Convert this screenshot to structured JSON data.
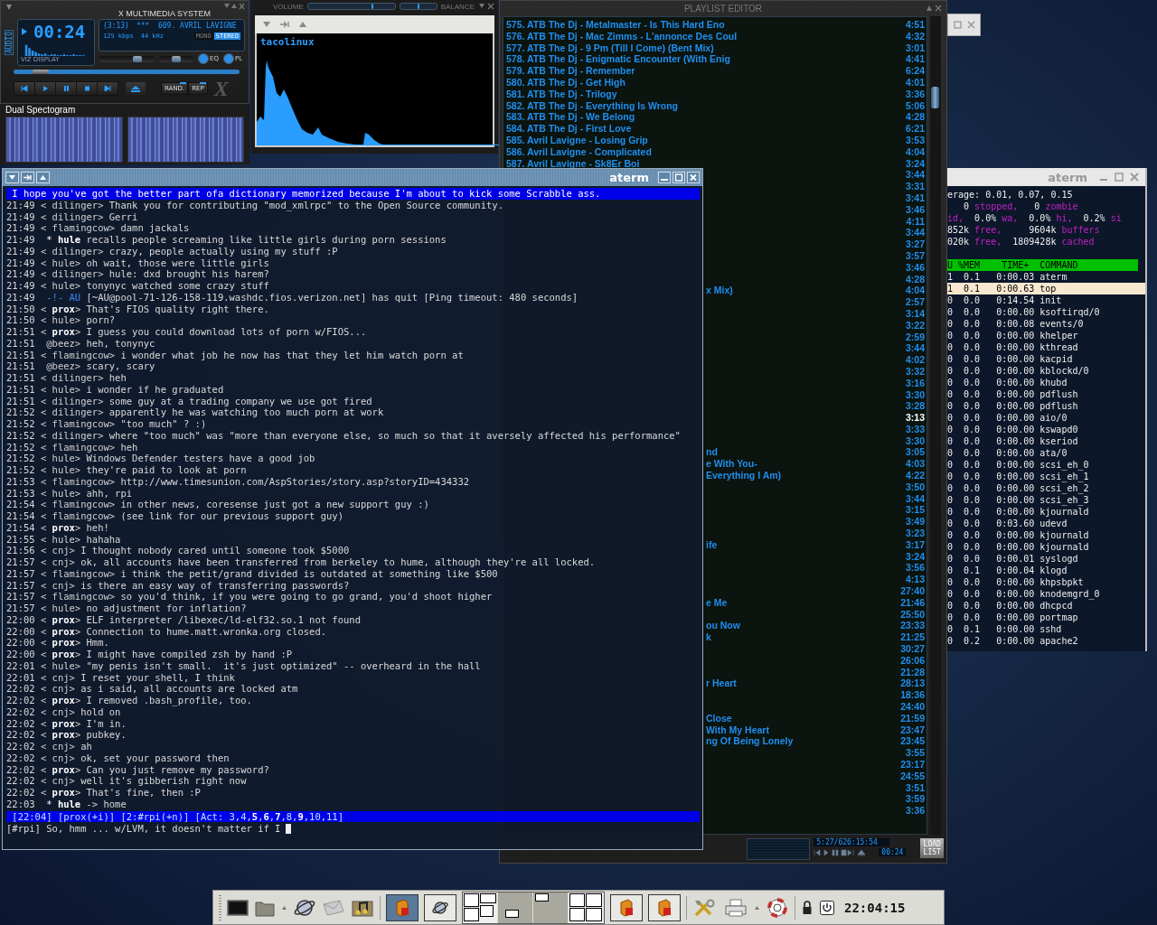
{
  "player": {
    "title": "X MULTIMEDIA SYSTEM",
    "side_label": "AUDIO",
    "viz_label": "VIZ DISPLAY",
    "time": "00:24",
    "track_time": "(3:13)",
    "marquee": "***  609. AVRIL LAVIGNE",
    "bitrate": "125 kbps",
    "samplerate": "44 kHz",
    "modes": [
      {
        "label": "MONO",
        "on": false
      },
      {
        "label": "STEREO",
        "on": true
      }
    ],
    "volume": {
      "level": 0.7
    },
    "balance": {
      "level": 0.5
    },
    "seek": {
      "level": 0.12
    },
    "panel_buttons": [
      {
        "label": "EQ",
        "on": true
      },
      {
        "label": "PL",
        "on": true
      }
    ],
    "toggles": [
      {
        "label": "RAND.",
        "on": true
      },
      {
        "label": "REP",
        "on": true
      }
    ],
    "logo": "X"
  },
  "spectrogram": {
    "title": "Dual Spectogram"
  },
  "visualizer": {
    "volume_label": "VOLUME",
    "balance_label": "BALANCE",
    "volume": {
      "level": 0.74
    },
    "balance": {
      "level": 0.5
    },
    "name": "tacolinux"
  },
  "playlist": {
    "title": "PLAYLIST EDITOR",
    "rows": [
      {
        "kind": "full",
        "title": "575. ATB The Dj - Metalmaster - Is This Hard Eno",
        "time": "4:51",
        "selected": false
      },
      {
        "kind": "full",
        "title": "576. ATB The Dj - Mac Zimms - L'annonce Des Coul",
        "time": "4:32",
        "selected": false
      },
      {
        "kind": "full",
        "title": "577. ATB The Dj - 9 Pm (Till I Come) (Bent Mix)",
        "time": "3:01",
        "selected": false
      },
      {
        "kind": "full",
        "title": "578. ATB The Dj - Enigmatic Encounter (With Enig",
        "time": "4:41",
        "selected": false
      },
      {
        "kind": "full",
        "title": "579. ATB The Dj - Remember",
        "time": "6:24",
        "selected": false
      },
      {
        "kind": "full",
        "title": "580. ATB The Dj - Get High",
        "time": "4:01",
        "selected": false
      },
      {
        "kind": "full",
        "title": "581. ATB The Dj - Trilogy",
        "time": "3:36",
        "selected": false
      },
      {
        "kind": "full",
        "title": "582. ATB The Dj - Everything Is Wrong",
        "time": "5:06",
        "selected": false
      },
      {
        "kind": "full",
        "title": "583. ATB The Dj - We Belong",
        "time": "4:28",
        "selected": false
      },
      {
        "kind": "full",
        "title": "584. ATB The Dj - First Love",
        "time": "6:21",
        "selected": false
      },
      {
        "kind": "full",
        "title": "585. Avril Lavigne - Losing Grip",
        "time": "3:53",
        "selected": false
      },
      {
        "kind": "full",
        "title": "586. Avril Lavigne - Complicated",
        "time": "4:04",
        "selected": false
      },
      {
        "kind": "full",
        "title": "587. Avril Lavigne - Sk8Er Boi",
        "time": "3:24",
        "selected": false
      },
      {
        "kind": "tail",
        "time": "3:44",
        "selected": false
      },
      {
        "kind": "tail",
        "time": "3:31",
        "selected": false
      },
      {
        "kind": "tail",
        "time": "3:41",
        "selected": false
      },
      {
        "kind": "tail",
        "time": "3:46",
        "selected": false
      },
      {
        "kind": "tail",
        "time": "4:11",
        "selected": false
      },
      {
        "kind": "tail",
        "time": "3:44",
        "selected": false
      },
      {
        "kind": "tail",
        "time": "3:27",
        "selected": false
      },
      {
        "kind": "tail",
        "time": "3:57",
        "selected": false
      },
      {
        "kind": "tail",
        "time": "3:46",
        "selected": false
      },
      {
        "kind": "tail",
        "time": "4:28",
        "selected": false
      },
      {
        "kind": "tail",
        "title": "x Mix)",
        "time": "4:04",
        "selected": false
      },
      {
        "kind": "tail",
        "time": "2:57",
        "selected": false
      },
      {
        "kind": "tail",
        "time": "3:14",
        "selected": false
      },
      {
        "kind": "tail",
        "time": "3:22",
        "selected": false
      },
      {
        "kind": "tail",
        "time": "2:59",
        "selected": false
      },
      {
        "kind": "tail",
        "time": "3:44",
        "selected": false
      },
      {
        "kind": "tail",
        "time": "4:02",
        "selected": false
      },
      {
        "kind": "tail",
        "time": "3:32",
        "selected": false
      },
      {
        "kind": "tail",
        "time": "3:16",
        "selected": false
      },
      {
        "kind": "tail",
        "time": "3:30",
        "selected": false
      },
      {
        "kind": "tail",
        "time": "3:28",
        "selected": false
      },
      {
        "kind": "tail",
        "time": "3:13",
        "selected": true
      },
      {
        "kind": "tail",
        "time": "3:33",
        "selected": false
      },
      {
        "kind": "tail",
        "time": "3:30",
        "selected": false
      },
      {
        "kind": "tail",
        "title": "nd",
        "time": "3:05",
        "selected": false
      },
      {
        "kind": "tail",
        "title": "e With You-",
        "time": "4:03",
        "selected": false
      },
      {
        "kind": "tail",
        "title": "Everything I Am)",
        "time": "4:22",
        "selected": false
      },
      {
        "kind": "tail",
        "time": "3:50",
        "selected": false
      },
      {
        "kind": "tail",
        "time": "3:44",
        "selected": false
      },
      {
        "kind": "tail",
        "time": "3:15",
        "selected": false
      },
      {
        "kind": "tail",
        "time": "3:49",
        "selected": false
      },
      {
        "kind": "tail",
        "time": "3:23",
        "selected": false
      },
      {
        "kind": "tail",
        "title": "ife",
        "time": "3:17",
        "selected": false
      },
      {
        "kind": "tail",
        "time": "3:24",
        "selected": false
      },
      {
        "kind": "tail",
        "time": "3:56",
        "selected": false
      },
      {
        "kind": "tail",
        "time": "4:13",
        "selected": false
      },
      {
        "kind": "tail",
        "time": "27:40",
        "selected": false
      },
      {
        "kind": "tail",
        "title": "e Me",
        "time": "21:46",
        "selected": false
      },
      {
        "kind": "tail",
        "time": "25:50",
        "selected": false
      },
      {
        "kind": "tail",
        "title": "ou Now",
        "time": "23:33",
        "selected": false
      },
      {
        "kind": "tail",
        "title": "k",
        "time": "21:25",
        "selected": false
      },
      {
        "kind": "tail",
        "time": "30:27",
        "selected": false
      },
      {
        "kind": "tail",
        "time": "26:06",
        "selected": false
      },
      {
        "kind": "tail",
        "time": "21:28",
        "selected": false
      },
      {
        "kind": "tail",
        "title": "r Heart",
        "time": "28:13",
        "selected": false
      },
      {
        "kind": "tail",
        "time": "18:36",
        "selected": false
      },
      {
        "kind": "tail",
        "time": "24:40",
        "selected": false
      },
      {
        "kind": "tail",
        "title": "Close",
        "time": "21:59",
        "selected": false
      },
      {
        "kind": "tail",
        "title": "With My Heart",
        "time": "23:47",
        "selected": false
      },
      {
        "kind": "tail",
        "title": "ng Of Being Lonely",
        "time": "23:45",
        "selected": false
      },
      {
        "kind": "tail",
        "time": "3:55",
        "selected": false
      },
      {
        "kind": "tail",
        "time": "23:17",
        "selected": false
      },
      {
        "kind": "tail",
        "time": "24:55",
        "selected": false
      },
      {
        "kind": "tail",
        "time": "3:51",
        "selected": false
      },
      {
        "kind": "tail",
        "time": "3:59",
        "selected": false
      },
      {
        "kind": "tail",
        "time": "3:36",
        "selected": false
      }
    ],
    "total": "5:27/626:15:54",
    "elapsed": "00:24",
    "load_button": "LOAD LIST"
  },
  "top_terminal": {
    "title": "aterm",
    "summary": [
      [
        {
          "text": "erage: 0.01, 0.07, 0.15",
          "kind": "value"
        }
      ],
      [
        {
          "text": "   0 ",
          "kind": "value"
        },
        {
          "text": "stopped,",
          "kind": "label"
        },
        {
          "text": "   0 ",
          "kind": "value"
        },
        {
          "text": "zombie",
          "kind": "label"
        }
      ],
      [
        {
          "text": "id,",
          "kind": "label"
        },
        {
          "text": "  0.0%",
          "kind": "value"
        },
        {
          "text": " wa,",
          "kind": "label"
        },
        {
          "text": "  0.0%",
          "kind": "value"
        },
        {
          "text": " hi,",
          "kind": "label"
        },
        {
          "text": "  0.2%",
          "kind": "value"
        },
        {
          "text": " si",
          "kind": "label"
        }
      ],
      [
        {
          "text": "852k",
          "kind": "value"
        },
        {
          "text": " free,",
          "kind": "label"
        },
        {
          "text": "     9604k",
          "kind": "value"
        },
        {
          "text": " buffers",
          "kind": "label"
        }
      ],
      [
        {
          "text": "020k",
          "kind": "value"
        },
        {
          "text": " free,",
          "kind": "label"
        },
        {
          "text": "  1809428k",
          "kind": "value"
        },
        {
          "text": " cached",
          "kind": "label"
        }
      ]
    ],
    "header": "U %MEM    TIME+  COMMAND",
    "processes": [
      {
        "cpu": "1",
        "mem": "0.1",
        "time": "0:00.03",
        "command": "aterm",
        "selected": false
      },
      {
        "cpu": "1",
        "mem": "0.1",
        "time": "0:00.63",
        "command": "top",
        "selected": true
      },
      {
        "cpu": "0",
        "mem": "0.0",
        "time": "0:14.54",
        "command": "init",
        "selected": false
      },
      {
        "cpu": "0",
        "mem": "0.0",
        "time": "0:00.00",
        "command": "ksoftirqd/0",
        "selected": false
      },
      {
        "cpu": "0",
        "mem": "0.0",
        "time": "0:00.08",
        "command": "events/0",
        "selected": false
      },
      {
        "cpu": "0",
        "mem": "0.0",
        "time": "0:00.00",
        "command": "khelper",
        "selected": false
      },
      {
        "cpu": "0",
        "mem": "0.0",
        "time": "0:00.00",
        "command": "kthread",
        "selected": false
      },
      {
        "cpu": "0",
        "mem": "0.0",
        "time": "0:00.00",
        "command": "kacpid",
        "selected": false
      },
      {
        "cpu": "0",
        "mem": "0.0",
        "time": "0:00.00",
        "command": "kblockd/0",
        "selected": false
      },
      {
        "cpu": "0",
        "mem": "0.0",
        "time": "0:00.00",
        "command": "khubd",
        "selected": false
      },
      {
        "cpu": "0",
        "mem": "0.0",
        "time": "0:00.00",
        "command": "pdflush",
        "selected": false
      },
      {
        "cpu": "0",
        "mem": "0.0",
        "time": "0:00.00",
        "command": "pdflush",
        "selected": false
      },
      {
        "cpu": "0",
        "mem": "0.0",
        "time": "0:00.00",
        "command": "aio/0",
        "selected": false
      },
      {
        "cpu": "0",
        "mem": "0.0",
        "time": "0:00.00",
        "command": "kswapd0",
        "selected": false
      },
      {
        "cpu": "0",
        "mem": "0.0",
        "time": "0:00.00",
        "command": "kseriod",
        "selected": false
      },
      {
        "cpu": "0",
        "mem": "0.0",
        "time": "0:00.00",
        "command": "ata/0",
        "selected": false
      },
      {
        "cpu": "0",
        "mem": "0.0",
        "time": "0:00.00",
        "command": "scsi_eh_0",
        "selected": false
      },
      {
        "cpu": "0",
        "mem": "0.0",
        "time": "0:00.00",
        "command": "scsi_eh_1",
        "selected": false
      },
      {
        "cpu": "0",
        "mem": "0.0",
        "time": "0:00.00",
        "command": "scsi_eh_2",
        "selected": false
      },
      {
        "cpu": "0",
        "mem": "0.0",
        "time": "0:00.00",
        "command": "scsi_eh_3",
        "selected": false
      },
      {
        "cpu": "0",
        "mem": "0.0",
        "time": "0:00.00",
        "command": "kjournald",
        "selected": false
      },
      {
        "cpu": "0",
        "mem": "0.0",
        "time": "0:03.60",
        "command": "udevd",
        "selected": false
      },
      {
        "cpu": "0",
        "mem": "0.0",
        "time": "0:00.00",
        "command": "kjournald",
        "selected": false
      },
      {
        "cpu": "0",
        "mem": "0.0",
        "time": "0:00.00",
        "command": "kjournald",
        "selected": false
      },
      {
        "cpu": "0",
        "mem": "0.0",
        "time": "0:00.01",
        "command": "syslogd",
        "selected": false
      },
      {
        "cpu": "0",
        "mem": "0.1",
        "time": "0:00.04",
        "command": "klogd",
        "selected": false
      },
      {
        "cpu": "0",
        "mem": "0.0",
        "time": "0:00.00",
        "command": "khpsbpkt",
        "selected": false
      },
      {
        "cpu": "0",
        "mem": "0.0",
        "time": "0:00.00",
        "command": "knodemgrd_0",
        "selected": false
      },
      {
        "cpu": "0",
        "mem": "0.0",
        "time": "0:00.00",
        "command": "dhcpcd",
        "selected": false
      },
      {
        "cpu": "0",
        "mem": "0.0",
        "time": "0:00.00",
        "command": "portmap",
        "selected": false
      },
      {
        "cpu": "0",
        "mem": "0.1",
        "time": "0:00.00",
        "command": "sshd",
        "selected": false
      },
      {
        "cpu": "0",
        "mem": "0.2",
        "time": "0:00.00",
        "command": "apache2",
        "selected": false
      }
    ]
  },
  "irc_terminal": {
    "title": "aterm",
    "topic": " I hope you've got the better part ofa dictionary memorized because I'm about to kick some Scrabble ass.",
    "lines": [
      {
        "time": "21:49",
        "kind": "msg",
        "nick": "< dilinger>",
        "text": "Thank you for contributing \"mod_xmlrpc\" to the Open Source community."
      },
      {
        "time": "21:49",
        "kind": "msg",
        "nick": "< dilinger>",
        "text": "Gerri"
      },
      {
        "time": "21:49",
        "kind": "msg",
        "nick": "< flamingcow>",
        "text": "damn jackals"
      },
      {
        "time": "21:49",
        "kind": "action",
        "nick": " * **hule**",
        "text": "recalls people screaming like little girls during porn sessions"
      },
      {
        "time": "21:49",
        "kind": "msg",
        "nick": "< dilinger>",
        "text": "crazy, people actually using my stuff :P"
      },
      {
        "time": "21:49",
        "kind": "msg",
        "nick": "< hule>",
        "text": "oh wait, those were little girls"
      },
      {
        "time": "21:49",
        "kind": "msg",
        "nick": "< dilinger>",
        "text": "hule: dxd brought his harem?"
      },
      {
        "time": "21:49",
        "kind": "msg",
        "nick": "< hule>",
        "text": "tonynyc watched some crazy stuff"
      },
      {
        "time": "21:49",
        "kind": "quit",
        "nick": " -!- AU",
        "text": "[~AU@pool-71-126-158-119.washdc.fios.verizon.net] has quit [Ping timeout: 480 seconds]"
      },
      {
        "time": "21:50",
        "kind": "msg",
        "nick": "< **prox**>",
        "text": "That's FIOS quality right there."
      },
      {
        "time": "21:50",
        "kind": "msg",
        "nick": "< hule>",
        "text": "porn?"
      },
      {
        "time": "21:51",
        "kind": "msg",
        "nick": "< **prox**>",
        "text": "I guess you could download lots of porn w/FIOS..."
      },
      {
        "time": "21:51",
        "kind": "msg",
        "nick": " @beez>",
        "text": "heh, tonynyc"
      },
      {
        "time": "21:51",
        "kind": "msg",
        "nick": "< flamingcow>",
        "text": "i wonder what job he now has that they let him watch porn at"
      },
      {
        "time": "21:51",
        "kind": "msg",
        "nick": " @beez>",
        "text": "scary, scary"
      },
      {
        "time": "21:51",
        "kind": "msg",
        "nick": "< dilinger>",
        "text": "heh"
      },
      {
        "time": "21:51",
        "kind": "msg",
        "nick": "< hule>",
        "text": "i wonder if he graduated"
      },
      {
        "time": "21:51",
        "kind": "msg",
        "nick": "< dilinger>",
        "text": "some guy at a trading company we use got fired"
      },
      {
        "time": "21:52",
        "kind": "msg",
        "nick": "< dilinger>",
        "text": "apparently he was watching too much porn at work"
      },
      {
        "time": "21:52",
        "kind": "msg",
        "nick": "< flamingcow>",
        "text": "\"too much\" ? :)"
      },
      {
        "time": "21:52",
        "kind": "msg",
        "nick": "< dilinger>",
        "text": "where \"too much\" was \"more than everyone else, so much so that it aversely affected his performance\""
      },
      {
        "time": "21:52",
        "kind": "msg",
        "nick": "< flamingcow>",
        "text": "heh"
      },
      {
        "time": "21:52",
        "kind": "msg",
        "nick": "< hule>",
        "text": "Windows Defender testers have a good job"
      },
      {
        "time": "21:52",
        "kind": "msg",
        "nick": "< hule>",
        "text": "they're paid to look at porn"
      },
      {
        "time": "21:53",
        "kind": "msg",
        "nick": "< flamingcow>",
        "text": "http://www.timesunion.com/AspStories/story.asp?storyID=434332"
      },
      {
        "time": "21:53",
        "kind": "msg",
        "nick": "< hule>",
        "text": "ahh, rpi"
      },
      {
        "time": "21:54",
        "kind": "msg",
        "nick": "< flamingcow>",
        "text": "in other news, coresense just got a new support guy :)"
      },
      {
        "time": "21:54",
        "kind": "msg",
        "nick": "< flamingcow>",
        "text": "(see link for our previous support guy)"
      },
      {
        "time": "21:54",
        "kind": "msg",
        "nick": "< **prox**>",
        "text": "heh!"
      },
      {
        "time": "21:55",
        "kind": "msg",
        "nick": "< hule>",
        "text": "hahaha"
      },
      {
        "time": "21:56",
        "kind": "msg",
        "nick": "< cnj>",
        "text": "I thought nobody cared until someone took $5000"
      },
      {
        "time": "21:57",
        "kind": "msg",
        "nick": "< cnj>",
        "text": "ok, all accounts have been transferred from berkeley to hume, although they're all locked."
      },
      {
        "time": "21:57",
        "kind": "msg",
        "nick": "< flamingcow>",
        "text": "i think the petit/grand divided is outdated at something like $500"
      },
      {
        "time": "21:57",
        "kind": "msg",
        "nick": "< cnj>",
        "text": "is there an easy way of transferring passwords?"
      },
      {
        "time": "21:57",
        "kind": "msg",
        "nick": "< flamingcow>",
        "text": "so you'd think, if you were going to go grand, you'd shoot higher"
      },
      {
        "time": "21:57",
        "kind": "msg",
        "nick": "< hule>",
        "text": "no adjustment for inflation?"
      },
      {
        "time": "22:00",
        "kind": "msg",
        "nick": "< **prox**>",
        "text": "ELF interpreter /libexec/ld-elf32.so.1 not found"
      },
      {
        "time": "22:00",
        "kind": "msg",
        "nick": "< **prox**>",
        "text": "Connection to hume.matt.wronka.org closed."
      },
      {
        "time": "22:00",
        "kind": "msg",
        "nick": "< **prox**>",
        "text": "Hmm."
      },
      {
        "time": "22:00",
        "kind": "msg",
        "nick": "< **prox**>",
        "text": "I might have compiled zsh by hand :P"
      },
      {
        "time": "22:01",
        "kind": "msg",
        "nick": "< hule>",
        "text": "\"my penis isn't small.  it's just optimized\" -- overheard in the hall"
      },
      {
        "time": "22:01",
        "kind": "msg",
        "nick": "< cnj>",
        "text": "I reset your shell, I think"
      },
      {
        "time": "22:02",
        "kind": "msg",
        "nick": "< cnj>",
        "text": "as i said, all accounts are locked atm"
      },
      {
        "time": "22:02",
        "kind": "msg",
        "nick": "< **prox**>",
        "text": "I removed .bash_profile, too."
      },
      {
        "time": "22:02",
        "kind": "msg",
        "nick": "< cnj>",
        "text": "hold on"
      },
      {
        "time": "22:02",
        "kind": "msg",
        "nick": "< **prox**>",
        "text": "I'm in."
      },
      {
        "time": "22:02",
        "kind": "msg",
        "nick": "< **prox**>",
        "text": "pubkey."
      },
      {
        "time": "22:02",
        "kind": "msg",
        "nick": "< cnj>",
        "text": "ah"
      },
      {
        "time": "22:02",
        "kind": "msg",
        "nick": "< cnj>",
        "text": "ok, set your password then"
      },
      {
        "time": "22:02",
        "kind": "msg",
        "nick": "< **prox**>",
        "text": "Can you just remove my password?"
      },
      {
        "time": "22:02",
        "kind": "msg",
        "nick": "< cnj>",
        "text": "well it's gibberish right now"
      },
      {
        "time": "22:02",
        "kind": "msg",
        "nick": "< **prox**>",
        "text": "That's fine, then :P"
      },
      {
        "time": "22:03",
        "kind": "action",
        "nick": " * **hule**",
        "text": "-> home"
      }
    ],
    "status": " [22:04] [prox(+i)] [2:#rpi(+n)] [Act: 3,4,**5**,**6**,**7**,8,**9**,10,11]",
    "input": "[#rpi] So, hmm ... w/LVM, it doesn't matter if I"
  },
  "taskbar": {
    "tasks": [
      {
        "kind": "app",
        "selected": true
      },
      {
        "kind": "browser",
        "selected": false
      }
    ],
    "tasks_after": [
      {
        "kind": "app",
        "selected": false
      },
      {
        "kind": "app",
        "selected": false
      }
    ],
    "clock": "22:04:15"
  }
}
